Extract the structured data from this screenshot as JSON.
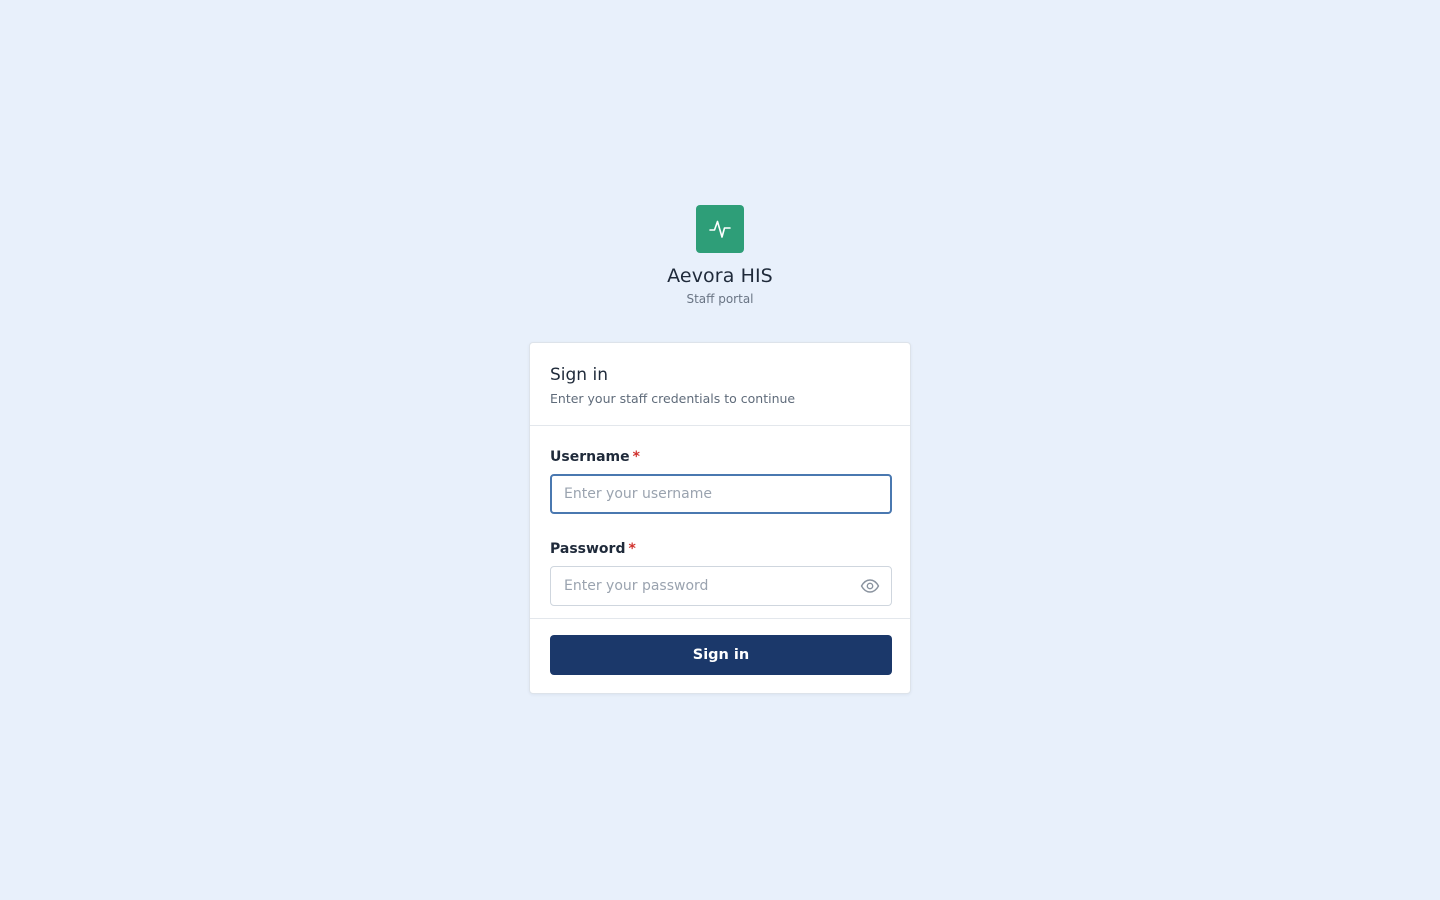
{
  "brand": {
    "title": "Aevora HIS",
    "subtitle": "Staff portal",
    "logo_icon": "pulse-icon",
    "logo_color": "#2e9e78"
  },
  "card": {
    "title": "Sign in",
    "subtitle": "Enter your staff credentials to continue"
  },
  "form": {
    "username": {
      "label": "Username",
      "required_mark": "*",
      "value": "",
      "placeholder": "Enter your username"
    },
    "password": {
      "label": "Password",
      "required_mark": "*",
      "value": "",
      "placeholder": "Enter your password",
      "toggle_icon": "eye-icon"
    },
    "submit_label": "Sign in"
  },
  "colors": {
    "background": "#e8f0fb",
    "primary_button": "#1b386a",
    "focus_border": "#4a78b0",
    "required": "#d0312d"
  }
}
